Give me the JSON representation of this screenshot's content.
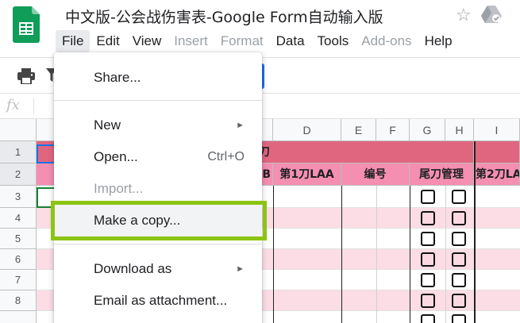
{
  "app": {
    "doc_title": "中文版-公会战伤害表-Google Form自动输入版",
    "star_icon": "star-icon",
    "drive_icon": "drive-status-icon"
  },
  "menubar": {
    "items": [
      {
        "label": "File",
        "state": "active"
      },
      {
        "label": "Edit",
        "state": "enabled"
      },
      {
        "label": "View",
        "state": "enabled"
      },
      {
        "label": "Insert",
        "state": "disabled"
      },
      {
        "label": "Format",
        "state": "disabled"
      },
      {
        "label": "Data",
        "state": "enabled"
      },
      {
        "label": "Tools",
        "state": "enabled"
      },
      {
        "label": "Add-ons",
        "state": "disabled"
      },
      {
        "label": "Help",
        "state": "enabled"
      }
    ]
  },
  "formula_bar": {
    "fx_label": "fx"
  },
  "sheet": {
    "columns": [
      "D",
      "E",
      "F",
      "G",
      "H",
      "I"
    ],
    "rows": [
      "1",
      "2",
      "3",
      "4",
      "5",
      "6",
      "7",
      "8"
    ],
    "row1_header": "第1刀",
    "row2_headers": [
      "B",
      "第1刀LAA",
      "编号",
      "尾刀管理",
      "第2刀LA"
    ]
  },
  "file_menu": {
    "items": [
      {
        "label": "Share...",
        "shortcut": "",
        "submenu": false,
        "disabled": false
      },
      {
        "label": "New",
        "shortcut": "",
        "submenu": true,
        "disabled": false
      },
      {
        "label": "Open...",
        "shortcut": "Ctrl+O",
        "submenu": false,
        "disabled": false
      },
      {
        "label": "Import...",
        "shortcut": "",
        "submenu": false,
        "disabled": true
      },
      {
        "label": "Make a copy...",
        "shortcut": "",
        "submenu": false,
        "disabled": false,
        "highlighted": true
      },
      {
        "label": "Download as",
        "shortcut": "",
        "submenu": true,
        "disabled": false
      },
      {
        "label": "Email as attachment...",
        "shortcut": "",
        "submenu": false,
        "disabled": false
      }
    ],
    "submenu_arrow": "►"
  },
  "colors": {
    "header_pink": "#e06680",
    "row2_pink": "#f48fb1",
    "band_pink": "#fcdde5",
    "highlight_green": "#8cc414",
    "accent_blue": "#1a73e8"
  }
}
